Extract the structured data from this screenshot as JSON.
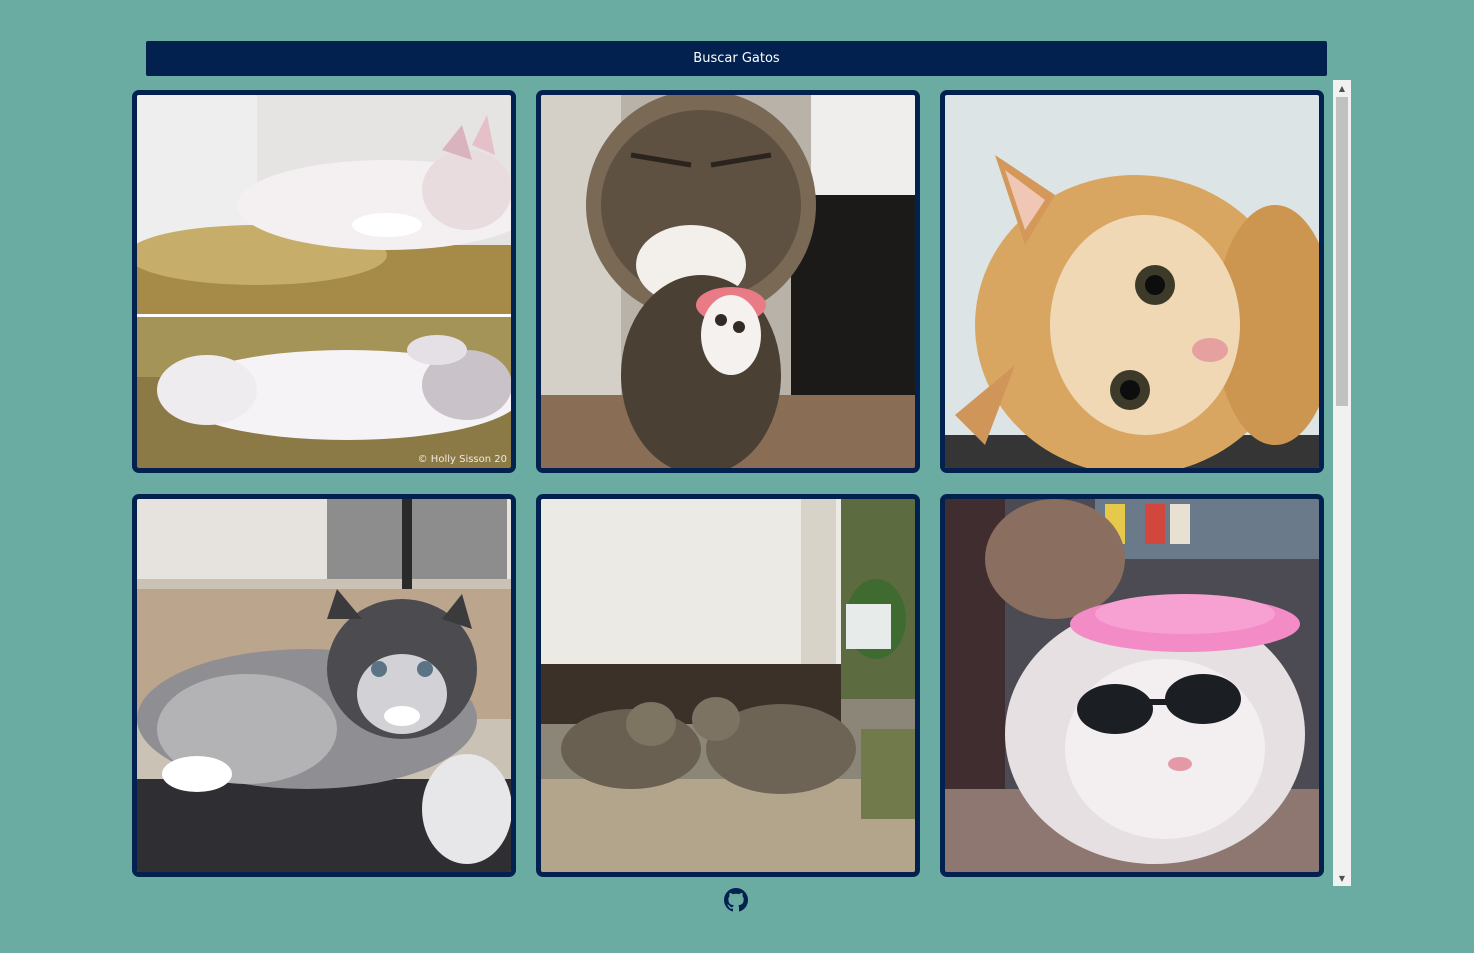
{
  "search_button": {
    "label": "Buscar Gatos"
  },
  "cats": [
    {
      "alt": "sleeping white kitten",
      "credit": "© Holly Sisson 20"
    },
    {
      "alt": "tabby kitten licking paw",
      "credit": ""
    },
    {
      "alt": "ginger kitten lying down",
      "credit": ""
    },
    {
      "alt": "grey fluffy kitten",
      "credit": ""
    },
    {
      "alt": "two tabby kittens by a wall",
      "credit": ""
    },
    {
      "alt": "white persian cat with sunglasses and pink visor",
      "credit": ""
    }
  ],
  "footer": {
    "icon": "github-icon"
  },
  "colors": {
    "background": "#6aaca1",
    "accent": "#03214f"
  }
}
